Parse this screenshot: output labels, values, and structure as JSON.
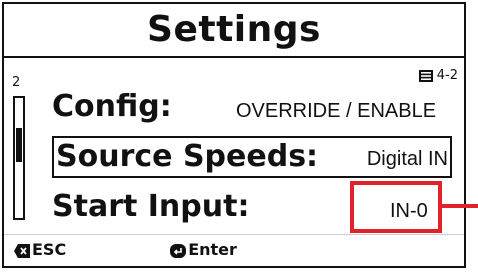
{
  "screen": {
    "title": "Settings",
    "page_indicator": "4-2",
    "scroll_position": "2"
  },
  "rows": [
    {
      "label": "Config:",
      "value": "OVERRIDE / ENABLE"
    },
    {
      "label": "Source Speeds:",
      "value": "Digital IN"
    },
    {
      "label": "Start Input:",
      "value": "IN-0"
    }
  ],
  "footer": {
    "esc_label": "ESC",
    "enter_label": "Enter"
  },
  "colors": {
    "highlight": "#e1222b",
    "foreground": "#111111",
    "background": "#ffffff"
  },
  "icons": {
    "page": "page-list-icon",
    "esc": "esc-key-icon",
    "enter": "enter-key-icon"
  }
}
